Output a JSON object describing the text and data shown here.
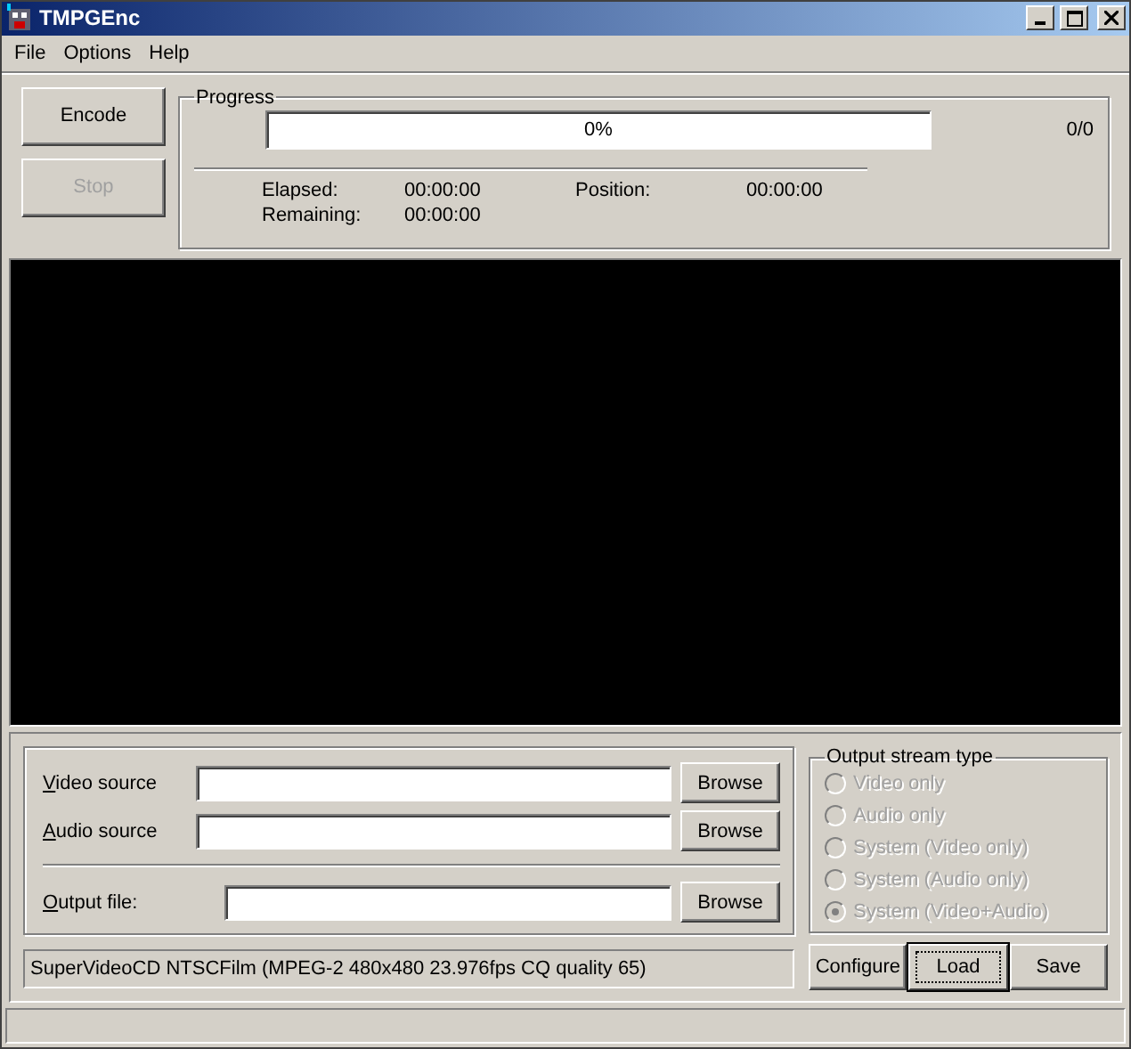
{
  "window": {
    "title": "TMPGEnc"
  },
  "menu": [
    "File",
    "Options",
    "Help"
  ],
  "actions": [
    {
      "label": "Encode",
      "disabled": false
    },
    {
      "label": "Stop",
      "disabled": true
    }
  ],
  "progress": {
    "title": "Progress",
    "level": 0,
    "percent": "0%",
    "count": "0/0",
    "stats": [
      {
        "label": "Elapsed:",
        "value": "00:00:00"
      },
      {
        "label": "Position:",
        "value": "00:00:00"
      },
      {
        "label": "Remaining:",
        "value": "00:00:00"
      }
    ]
  },
  "sources": [
    {
      "label": "Video source",
      "button": "Browse"
    },
    {
      "label": "Audio source",
      "button": "Browse"
    }
  ],
  "output": {
    "label": "Output file:",
    "button": "Browse"
  },
  "profile": "SuperVideoCD NTSCFilm (MPEG-2 480x480 23.976fps CQ quality 65)",
  "stream_type": {
    "title": "Output stream type",
    "disabled": true,
    "options": [
      {
        "label": "Video only",
        "selected": false
      },
      {
        "label": "Audio only",
        "selected": false
      },
      {
        "label": "System (Video only)",
        "selected": false
      },
      {
        "label": "System (Audio only)",
        "selected": false
      },
      {
        "label": "System (Video+Audio)",
        "selected": true
      }
    ]
  },
  "buttons": [
    {
      "label": "Configure",
      "focused": false
    },
    {
      "label": "Load",
      "focused": true
    },
    {
      "label": "Save",
      "focused": false
    }
  ]
}
